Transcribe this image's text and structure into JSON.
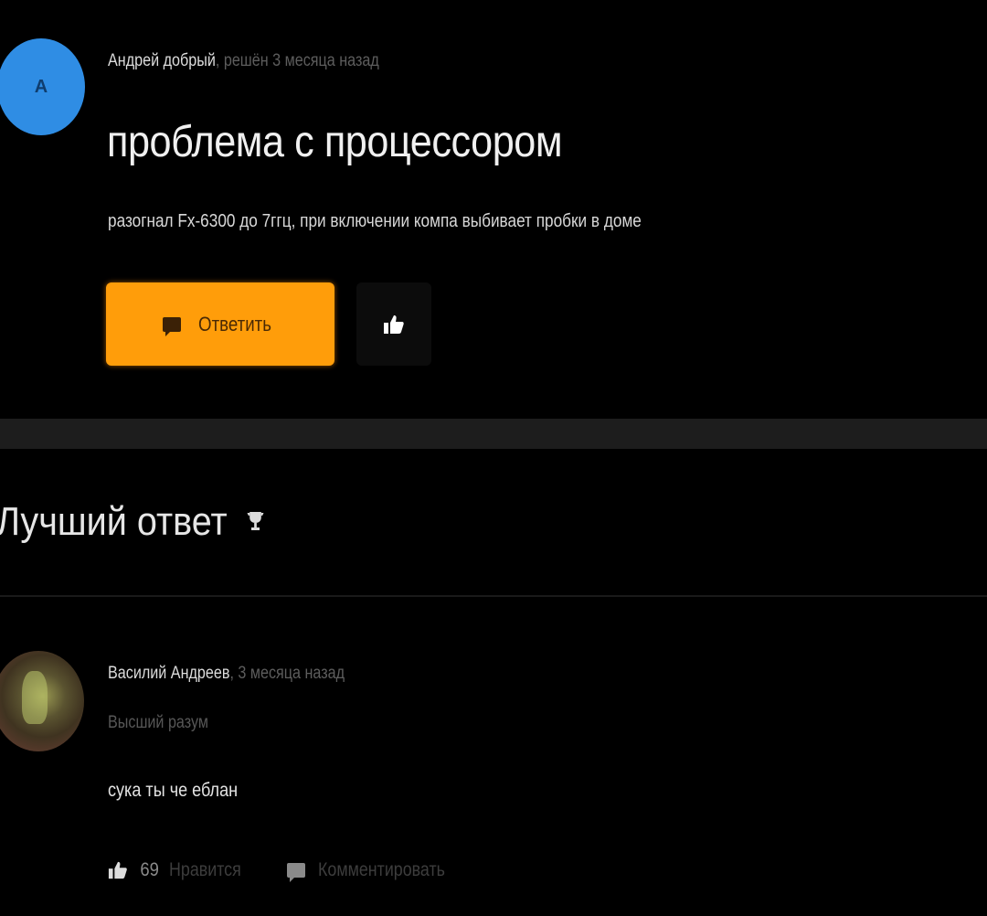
{
  "question": {
    "avatar_letter": "А",
    "author": "Андрей добрый",
    "status": ", решён 3 месяца назад",
    "title": "проблема с процессором",
    "body": "разогнал Fx-6300 до 7ггц, при включении компа выбивает пробки в доме",
    "answer_button_label": "Ответить",
    "avatar_color": "#2f8de4",
    "accent_color": "#ff9d0a",
    "icons": {
      "answer": "chat-icon",
      "like": "thumbs-up-icon"
    }
  },
  "best_answer": {
    "heading": "Лучший ответ",
    "icon": "trophy-icon",
    "author": "Василий Андреев",
    "time": ", 3 месяца назад",
    "rank": "Высший разум",
    "body": "сука ты че еблан",
    "like_count": "69",
    "like_label": "Нравится",
    "comment_label": "Комментировать"
  }
}
